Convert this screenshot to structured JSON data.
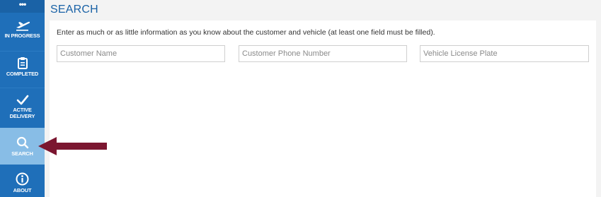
{
  "sidebar": {
    "top_label": "•••",
    "items": [
      {
        "label_lines": [
          "IN PROGRESS"
        ],
        "icon": "airplane-icon",
        "active": false
      },
      {
        "label_lines": [
          "COMPLETED"
        ],
        "icon": "clipboard-icon",
        "active": false
      },
      {
        "label_lines": [
          "ACTIVE",
          "DELIVERY"
        ],
        "icon": "checkmark-icon",
        "active": false
      },
      {
        "label_lines": [
          "SEARCH"
        ],
        "icon": "search-icon",
        "active": true
      },
      {
        "label_lines": [
          "ABOUT"
        ],
        "icon": "info-icon",
        "active": false
      }
    ]
  },
  "page": {
    "title": "SEARCH",
    "instructions": "Enter as much or as little information as you know about the customer and vehicle (at least one field must be filled)."
  },
  "fields": {
    "customer_name": {
      "placeholder": "Customer Name",
      "value": ""
    },
    "customer_phone": {
      "placeholder": "Customer Phone Number",
      "value": ""
    },
    "license_plate": {
      "placeholder": "Vehicle License Plate",
      "value": ""
    }
  },
  "colors": {
    "sidebar": "#1f6fb9",
    "sidebar_active": "#88bde6",
    "title": "#1a62a6",
    "annotation_arrow": "#7b1630"
  }
}
